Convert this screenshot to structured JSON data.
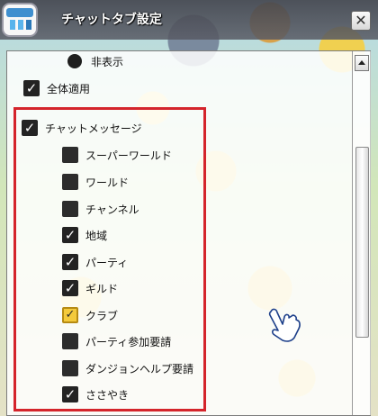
{
  "window": {
    "title": "チャットタブ設定",
    "close_glyph": "✕"
  },
  "options": {
    "hide": {
      "label": "非表示",
      "icon": "radio-button-icon"
    },
    "apply_all": {
      "label": "全体適用",
      "checked": true
    }
  },
  "chat_messages": {
    "header": {
      "label": "チャットメッセージ",
      "checked": true
    },
    "items": [
      {
        "label": "スーパーワールド",
        "checked": false
      },
      {
        "label": "ワールド",
        "checked": false
      },
      {
        "label": "チャンネル",
        "checked": false
      },
      {
        "label": "地域",
        "checked": true
      },
      {
        "label": "パーティ",
        "checked": true
      },
      {
        "label": "ギルド",
        "checked": true
      },
      {
        "label": "クラブ",
        "checked": true,
        "highlighted": true
      },
      {
        "label": "パーティ参加要請",
        "checked": false
      },
      {
        "label": "ダンジョンヘルプ要請",
        "checked": false
      },
      {
        "label": "ささやき",
        "checked": true
      }
    ]
  },
  "check_glyph": "✓",
  "colors": {
    "group_border": "#d4242b",
    "checkbox_fill": "#232323",
    "highlight_fill": "#f4ca3c"
  }
}
